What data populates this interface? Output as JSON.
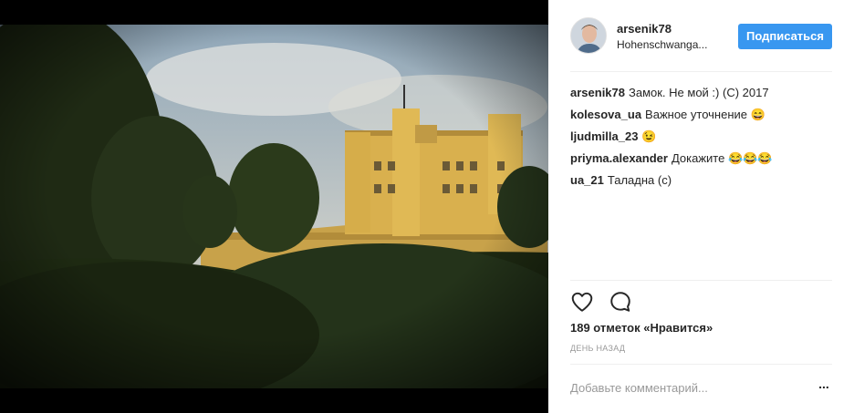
{
  "post": {
    "image_alt": "",
    "username": "arsenik78",
    "location": "Hohenschwanga...",
    "follow_label": "Подписаться",
    "comments": [
      {
        "author": "arsenik78",
        "text": "Замок. Не мой :) (С) 2017"
      },
      {
        "author": "kolesova_ua",
        "text": "Важное уточнение 😄"
      },
      {
        "author": "ljudmilla_23",
        "text": "😉"
      },
      {
        "author": "priyma.alexander",
        "text": "Докажите 😂😂😂"
      },
      {
        "author": "ua_21",
        "text": "Таладна (с)"
      }
    ],
    "icons": {
      "like": "heart-icon",
      "comment": "comment-bubble-icon",
      "more": "more-options-icon"
    },
    "likes": "189 отметок «Нравится»",
    "timestamp": "ДЕНЬ НАЗАД",
    "comment_placeholder": "Добавьте комментарий...",
    "more_label": "..."
  },
  "colors": {
    "accent": "#3897f0",
    "text": "#262626",
    "muted": "#999999",
    "divider": "#efefef"
  }
}
